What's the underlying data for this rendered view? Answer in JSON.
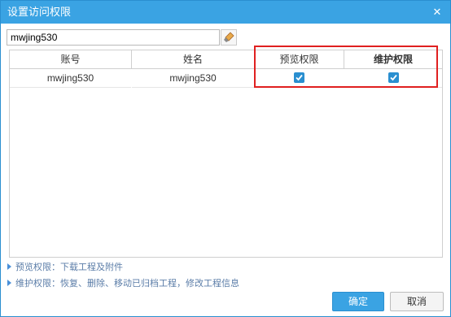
{
  "dialog": {
    "title": "设置访问权限",
    "close_icon": "close-icon"
  },
  "search": {
    "value": "mwjing530",
    "clear_icon": "clear-brush-icon"
  },
  "table": {
    "columns": [
      "账号",
      "姓名",
      "预览权限",
      "维护权限"
    ],
    "rows": [
      {
        "account": "mwjing530",
        "name": "mwjing530",
        "preview": true,
        "maintain": true
      }
    ]
  },
  "notes": {
    "preview": "预览权限：下载工程及附件",
    "maintain": "维护权限：恢复、删除、移动已归档工程，修改工程信息"
  },
  "buttons": {
    "ok": "确定",
    "cancel": "取消"
  },
  "colors": {
    "accent": "#3aa3e3",
    "highlight": "#e02020"
  }
}
